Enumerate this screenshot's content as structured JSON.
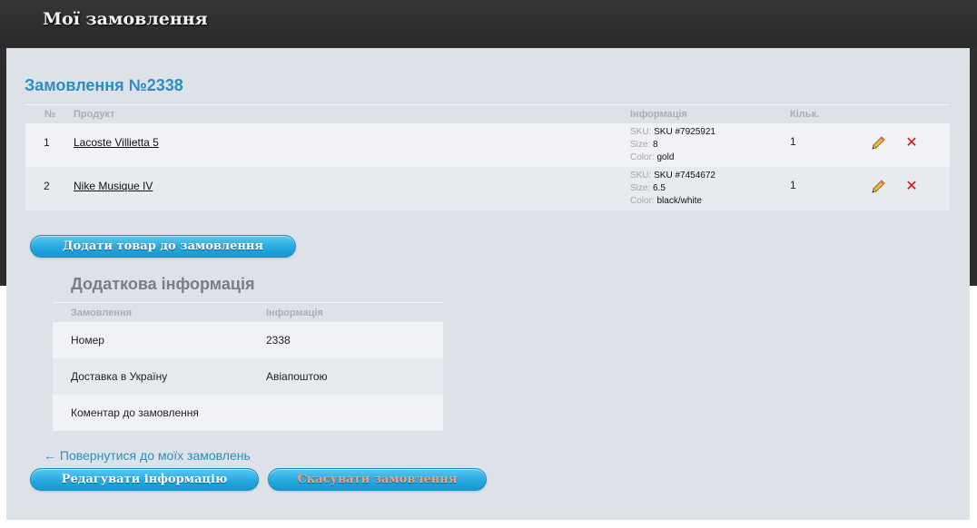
{
  "header": {
    "title": "Мої замовлення"
  },
  "order": {
    "title": "Замовлення №2338",
    "columns": {
      "num": "№",
      "product": "Продукт",
      "info": "Інформація",
      "qty": "Кільк."
    },
    "items": [
      {
        "num": "1",
        "product": "Lacoste Villietta 5",
        "sku_label": "SKU:",
        "sku": "SKU #7925921",
        "size_label": "Size:",
        "size": "8",
        "color_label": "Color:",
        "color": "gold",
        "qty": "1"
      },
      {
        "num": "2",
        "product": "Nike Musique IV",
        "sku_label": "SKU:",
        "sku": "SKU #7454672",
        "size_label": "Size:",
        "size": "6.5",
        "color_label": "Color:",
        "color": "black/white",
        "qty": "1"
      }
    ],
    "icons": {
      "edit": "pencil-icon",
      "delete": "close-icon"
    }
  },
  "buttons": {
    "add_item": "Додати товар до замовлення",
    "edit_info": "Редагувати інформацію",
    "cancel_order": "Скасувати замовлення"
  },
  "additional": {
    "title": "Додаткова інформація",
    "columns": {
      "order": "Замовлення",
      "info": "Інформація"
    },
    "rows": [
      {
        "label": "Номер",
        "value": "2338"
      },
      {
        "label": "Доставка в Україну",
        "value": "Авіапоштою"
      },
      {
        "label": "Коментар до замовлення",
        "value": ""
      }
    ]
  },
  "back_link": "← Повернутися до моїх замовлень",
  "colors": {
    "accent": "#2a8fc0",
    "button": "#26a9e0",
    "cancel_text": "#f7a07a",
    "delete": "#e01010"
  }
}
